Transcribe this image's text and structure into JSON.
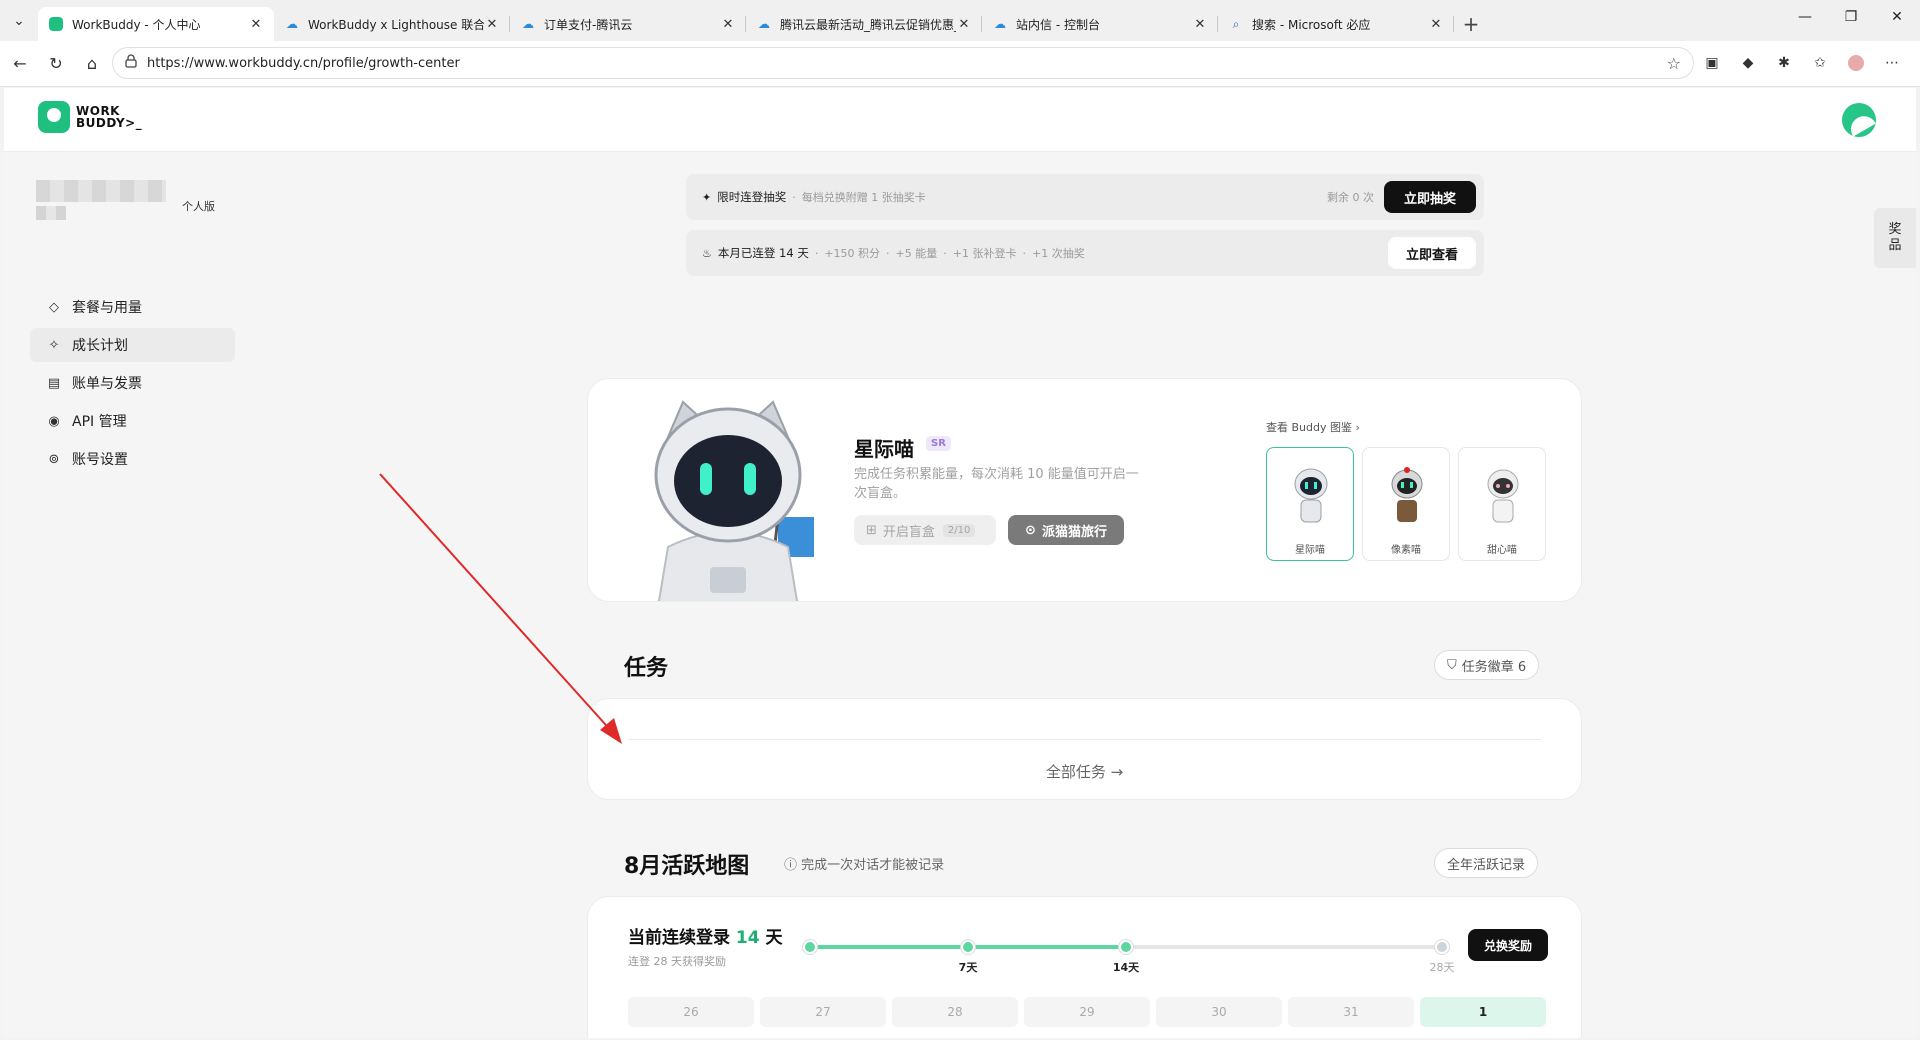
{
  "browser": {
    "tabs": [
      {
        "title": "WorkBuddy - 个人中心",
        "active": true
      },
      {
        "title": "WorkBuddy x Lighthouse 联合解决",
        "active": false
      },
      {
        "title": "订单支付-腾讯云",
        "active": false
      },
      {
        "title": "腾讯云最新活动_腾讯云促销优惠_",
        "active": false
      },
      {
        "title": "站内信 - 控制台",
        "active": false
      },
      {
        "title": "搜索 - Microsoft 必应",
        "active": false
      }
    ],
    "url": "https://www.workbuddy.cn/profile/growth-center"
  },
  "header": {
    "logo_line1": "WORK",
    "logo_line2": "BUDDY>_"
  },
  "sidebar": {
    "plan_tag": "个人版",
    "items": [
      {
        "label": "套餐与用量",
        "icon": "diamond-icon"
      },
      {
        "label": "成长计划",
        "icon": "sparkle-icon",
        "active": true
      },
      {
        "label": "账单与发票",
        "icon": "receipt-icon"
      },
      {
        "label": "API 管理",
        "icon": "eye-icon"
      },
      {
        "label": "账号设置",
        "icon": "settings-icon"
      }
    ]
  },
  "prize_tab": "奖品",
  "banner1": {
    "title": "限时连登抽奖",
    "desc": "每档兑换附赠 1 张抽奖卡",
    "remain": "剩余 0 次",
    "button": "立即抽奖"
  },
  "banner2": {
    "title": "本月已连登 14 天",
    "rewards": [
      "+150 积分",
      "+5 能量",
      "+1 张补登卡",
      "+1 次抽奖"
    ],
    "button": "立即查看"
  },
  "buddy": {
    "name": "星际喵",
    "rarity": "SR",
    "desc": "完成任务积累能量，每次消耗 10 能量值可开启一次盲盒。",
    "open_box_label": "开启盲盒",
    "open_box_count": "2/10",
    "trip_label": "派猫猫旅行",
    "gallery_link": "查看 Buddy 图鉴",
    "gallery": [
      {
        "label": "星际喵",
        "selected": true
      },
      {
        "label": "像素喵",
        "selected": false
      },
      {
        "label": "甜心喵",
        "selected": false
      }
    ]
  },
  "tasks": {
    "title": "任务",
    "badge": "任务徽章 6",
    "all_link": "全部任务 →"
  },
  "activity": {
    "title": "8月活跃地图",
    "hint": "完成一次对话才能被记录",
    "year_link": "全年活跃记录",
    "streak_prefix": "当前连续登录",
    "streak_num": "14",
    "streak_unit": "天",
    "streak_sub": "连登 28 天获得奖励",
    "progress_fraction": 0.5,
    "milestones": [
      {
        "label": "",
        "reached": true
      },
      {
        "label": "7天",
        "reached": true
      },
      {
        "label": "14天",
        "reached": true
      },
      {
        "label": "28天",
        "reached": false
      }
    ],
    "redeem_button": "兑换奖励",
    "days": [
      {
        "label": "26",
        "current": false
      },
      {
        "label": "27",
        "current": false
      },
      {
        "label": "28",
        "current": false
      },
      {
        "label": "29",
        "current": false
      },
      {
        "label": "30",
        "current": false
      },
      {
        "label": "31",
        "current": false
      },
      {
        "label": "1",
        "current": true
      }
    ]
  },
  "colors": {
    "accent": "#1cae72",
    "progress": "#5dd7a2",
    "annotation_arrow": "#e02a2a"
  }
}
